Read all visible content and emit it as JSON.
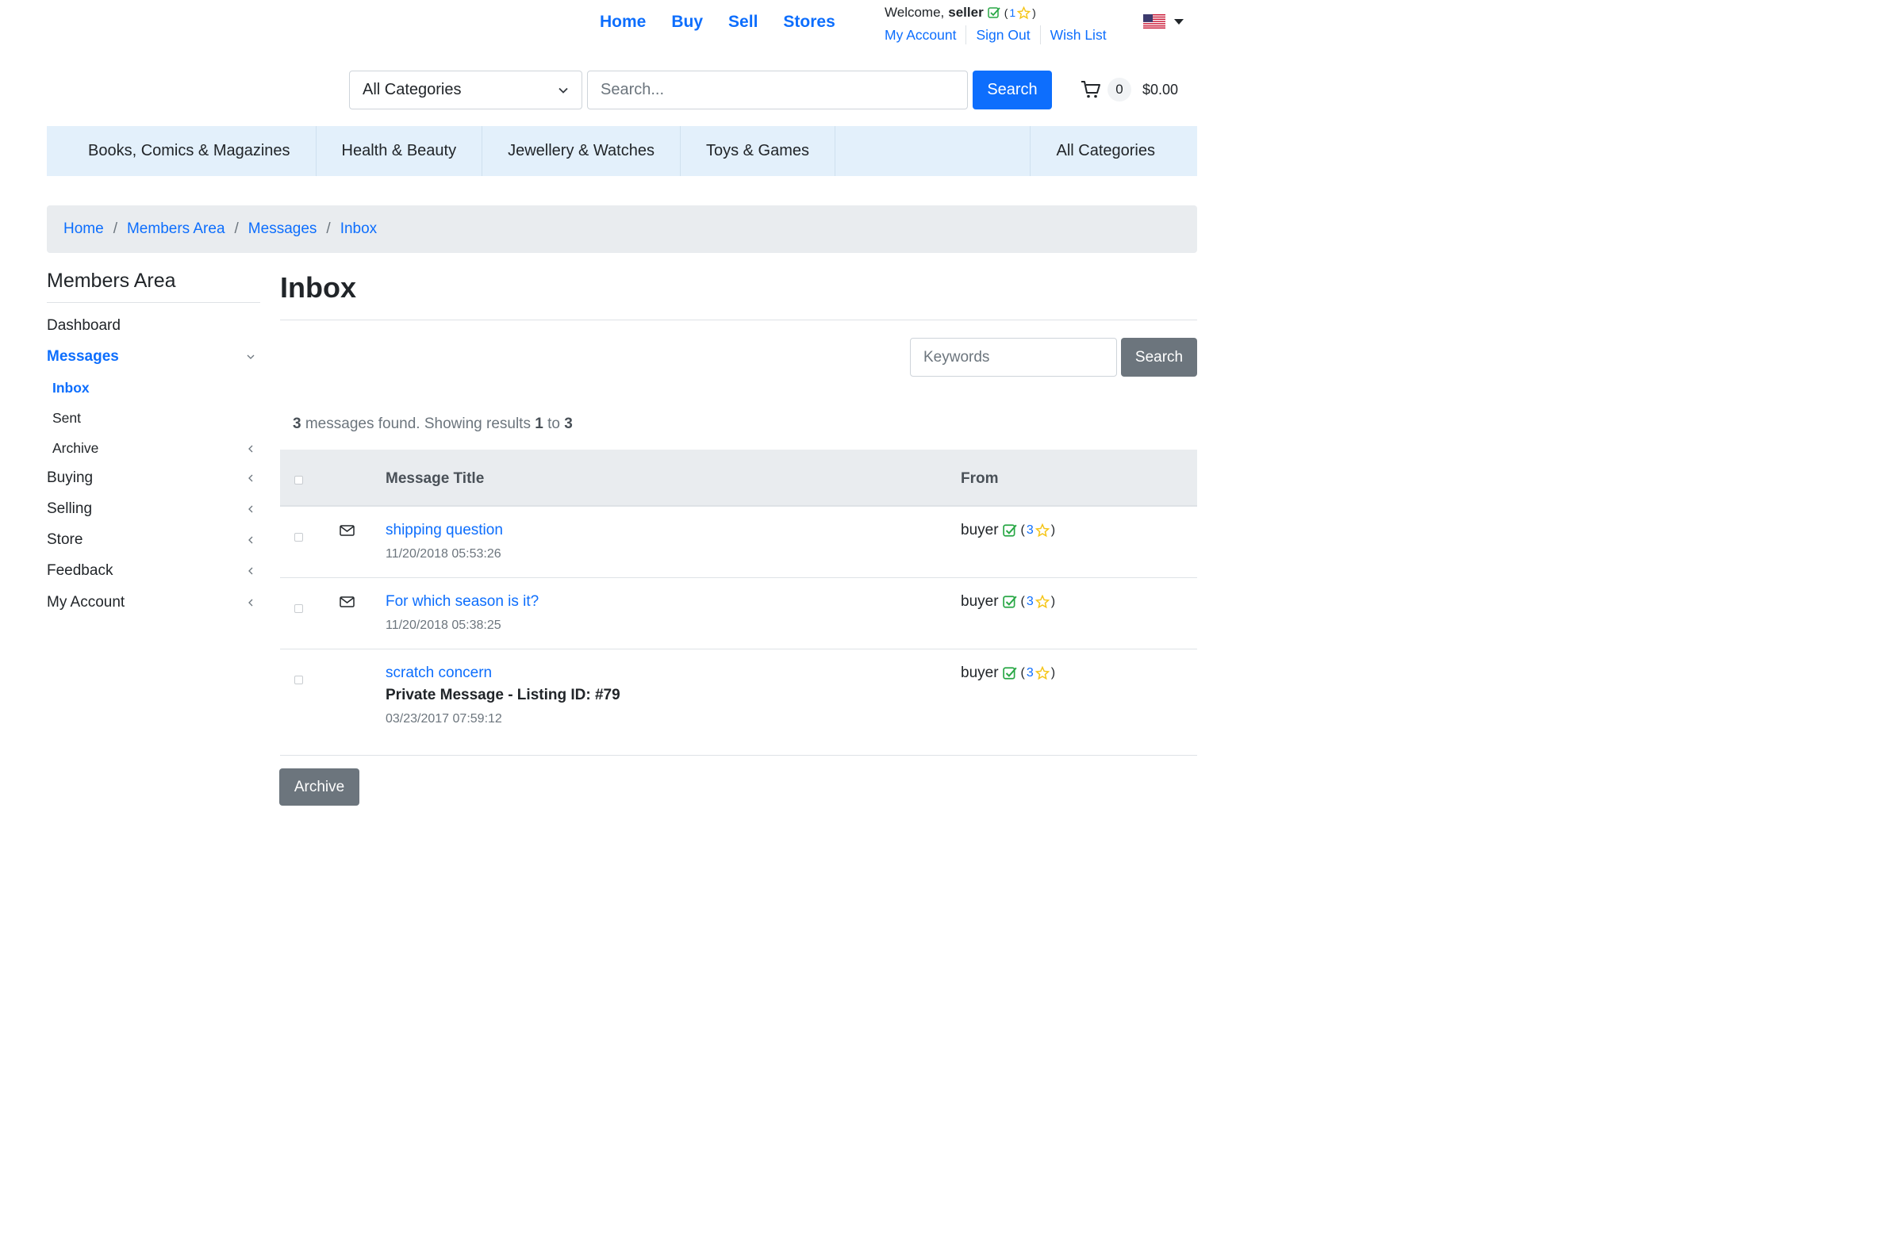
{
  "topnav": [
    "Home",
    "Buy",
    "Sell",
    "Stores"
  ],
  "user": {
    "welcome": "Welcome,",
    "name": "seller",
    "rating_open": "(",
    "rating": "1",
    "rating_close": ")",
    "links": [
      "My Account",
      "Sign Out",
      "Wish List"
    ]
  },
  "search": {
    "category": "All Categories",
    "placeholder": "Search...",
    "button": "Search"
  },
  "cart": {
    "count": "0",
    "total": "$0.00"
  },
  "categories": [
    "Books, Comics & Magazines",
    "Health & Beauty",
    "Jewellery & Watches",
    "Toys & Games",
    "All Categories"
  ],
  "breadcrumb": [
    "Home",
    "Members Area",
    "Messages",
    "Inbox"
  ],
  "sidebar": {
    "title": "Members Area",
    "items": [
      "Dashboard",
      "Messages",
      "Inbox",
      "Sent",
      "Archive",
      "Buying",
      "Selling",
      "Store",
      "Feedback",
      "My Account"
    ]
  },
  "main": {
    "title": "Inbox",
    "keywords_placeholder": "Keywords",
    "search_button": "Search",
    "results": {
      "count": "3",
      "text1": " messages found. Showing results ",
      "from": "1",
      "to_word": " to ",
      "to": "3"
    },
    "columns": {
      "title": "Message Title",
      "from": "From"
    },
    "messages": [
      {
        "title": "shipping question",
        "date": "11/20/2018 05:53:26",
        "from": "buyer",
        "rating": "3",
        "unread": true
      },
      {
        "title": "For which season is it?",
        "date": "11/20/2018 05:38:25",
        "from": "buyer",
        "rating": "3",
        "unread": true
      },
      {
        "title": "scratch concern",
        "subtitle": "Private Message - Listing ID: #79",
        "date": "03/23/2017 07:59:12",
        "from": "buyer",
        "rating": "3",
        "unread": false
      }
    ],
    "archive_button": "Archive"
  },
  "colors": {
    "primary": "#0d6efd",
    "secondary": "#6c757d",
    "verified": "#28a745",
    "star": "#f5c518",
    "catbar": "#e3f0fb"
  }
}
